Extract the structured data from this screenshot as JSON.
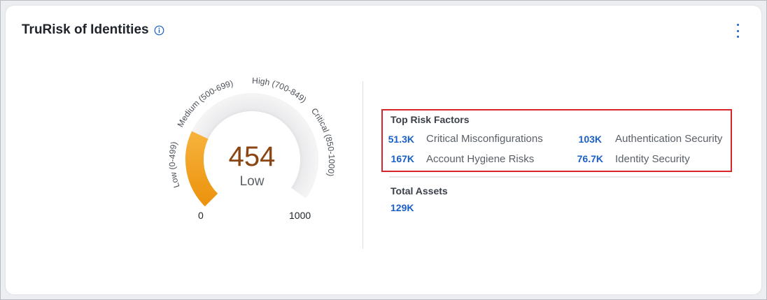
{
  "widget": {
    "title": "TruRisk of Identities"
  },
  "gauge": {
    "score": "454",
    "level": "Low",
    "min_label": "0",
    "max_label": "1000",
    "score_fraction": 0.454,
    "bands": [
      {
        "label": "Low (0-499)"
      },
      {
        "label": "Medium (500-699)"
      },
      {
        "label": "High (700-849)"
      },
      {
        "label": "Critical (850-1000)"
      }
    ],
    "colors": {
      "fill": "#f2a218",
      "track": "#e8e8ea",
      "score": "#8b4513"
    }
  },
  "top_risk_factors": {
    "title": "Top Risk Factors",
    "items": [
      {
        "value": "51.3K",
        "label": "Critical Misconfigurations"
      },
      {
        "value": "103K",
        "label": "Authentication Security"
      },
      {
        "value": "167K",
        "label": "Account Hygiene Risks"
      },
      {
        "value": "76.7K",
        "label": "Identity Security"
      }
    ]
  },
  "total_assets": {
    "title": "Total Assets",
    "value": "129K"
  },
  "icons": [
    "info-icon",
    "more-vertical-icon"
  ],
  "accent_color": "#1a5fc7",
  "highlight_color": "#d8252a"
}
